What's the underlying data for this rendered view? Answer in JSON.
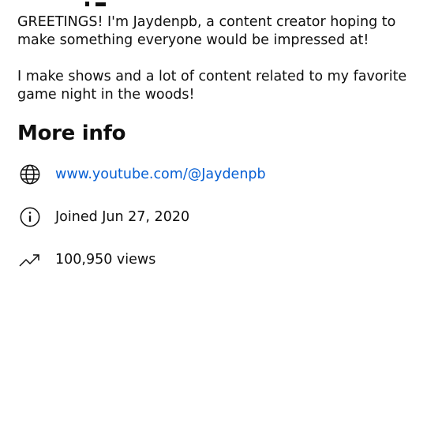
{
  "description": {
    "paragraph_1": "GREETINGS! I'm Jaydenpb, a content creator hoping to make something everyone would be impressed at!",
    "paragraph_2": "I make shows and a lot of content related to my favorite game night in the woods!"
  },
  "more_info": {
    "title": "More info",
    "link": "www.youtube.com/@Jaydenpb",
    "joined": "Joined Jun 27, 2020",
    "views": "100,950 views"
  },
  "icons": {
    "link": "globe-icon",
    "joined": "info-icon",
    "views": "trending-up-icon"
  },
  "colors": {
    "link": "#065fd4",
    "text": "#0f0f0f"
  }
}
